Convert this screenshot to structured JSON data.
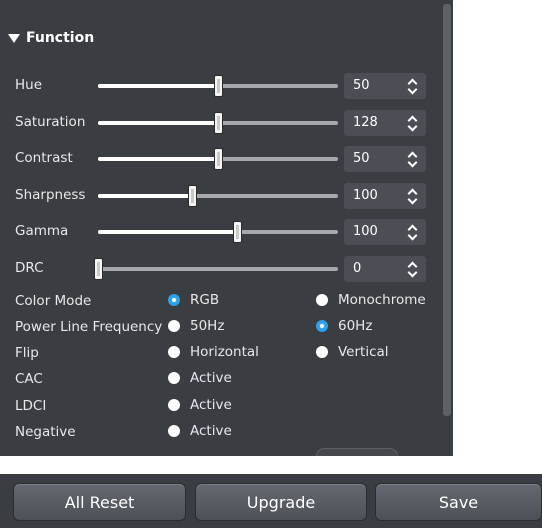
{
  "section": {
    "title": "Function"
  },
  "sliders": [
    {
      "label": "Hue",
      "value": "50",
      "level": 0.5
    },
    {
      "label": "Saturation",
      "value": "128",
      "level": 0.5
    },
    {
      "label": "Contrast",
      "value": "50",
      "level": 0.5
    },
    {
      "label": "Sharpness",
      "value": "100",
      "level": 0.39
    },
    {
      "label": "Gamma",
      "value": "100",
      "level": 0.58
    },
    {
      "label": "DRC",
      "value": "0",
      "level": 0.0
    }
  ],
  "radio_rows": [
    {
      "label": "Color Mode",
      "options": [
        {
          "label": "RGB",
          "selected": true
        },
        {
          "label": "Monochrome",
          "selected": false
        }
      ]
    },
    {
      "label": "Power Line Frequency",
      "options": [
        {
          "label": "50Hz",
          "selected": false
        },
        {
          "label": "60Hz",
          "selected": true
        }
      ]
    },
    {
      "label": "Flip",
      "options": [
        {
          "label": "Horizontal",
          "selected": false
        },
        {
          "label": "Vertical",
          "selected": false
        }
      ]
    },
    {
      "label": "CAC",
      "options": [
        {
          "label": "Active",
          "selected": false
        }
      ]
    },
    {
      "label": "LDCI",
      "options": [
        {
          "label": "Active",
          "selected": false
        }
      ]
    },
    {
      "label": "Negative",
      "options": [
        {
          "label": "Active",
          "selected": false
        }
      ]
    }
  ],
  "buttons": {
    "all_reset": "All Reset",
    "upgrade": "Upgrade",
    "save": "Save"
  },
  "colors": {
    "panel_bg": "#3a3d42",
    "accent": "#2da0ea",
    "spin_bg": "#4b4e54"
  }
}
